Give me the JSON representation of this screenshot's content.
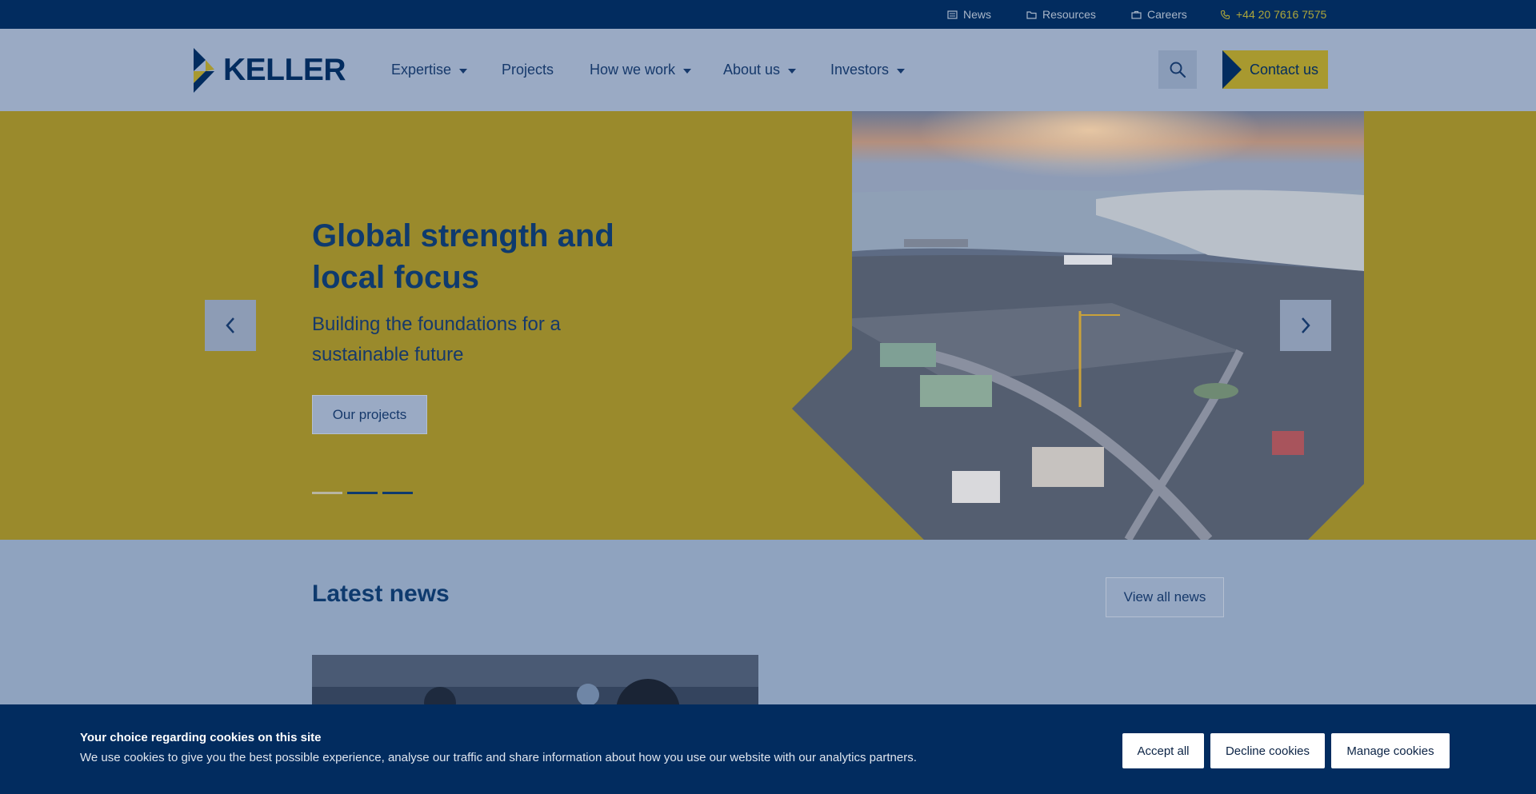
{
  "topbar": {
    "links": [
      {
        "label": "News",
        "icon": "newspaper-icon"
      },
      {
        "label": "Resources",
        "icon": "folder-icon"
      },
      {
        "label": "Careers",
        "icon": "briefcase-icon"
      }
    ],
    "phone": {
      "label": "+44 20 7616 7575",
      "icon": "phone-icon",
      "color": "#aea63a"
    }
  },
  "header": {
    "logo_text": "KELLER",
    "nav": [
      {
        "label": "Expertise",
        "has_dropdown": true
      },
      {
        "label": "Projects",
        "has_dropdown": false
      },
      {
        "label": "How we work",
        "has_dropdown": true
      },
      {
        "label": "About us",
        "has_dropdown": true
      },
      {
        "label": "Investors",
        "has_dropdown": true
      }
    ],
    "search_icon": "search-icon",
    "contact_label": "Contact us"
  },
  "hero": {
    "title": "Global strength and local focus",
    "subtitle": "Building the foundations for a sustainable future",
    "cta_label": "Our projects",
    "slides_total": 3,
    "active_slide": 1,
    "prev_icon": "chevron-left-icon",
    "next_icon": "chevron-right-icon"
  },
  "news": {
    "title": "Latest news",
    "view_all_label": "View all news"
  },
  "cookie": {
    "title": "Your choice regarding cookies on this site",
    "text": "We use cookies to give you the best possible experience, analyse our traffic and share information about how you use our website with our analytics partners.",
    "buttons": [
      "Accept all",
      "Decline cookies",
      "Manage cookies"
    ]
  },
  "colors": {
    "navy": "#022c5f",
    "gold": "#9a8a2c",
    "overlay_blue": "#9aaac4"
  }
}
